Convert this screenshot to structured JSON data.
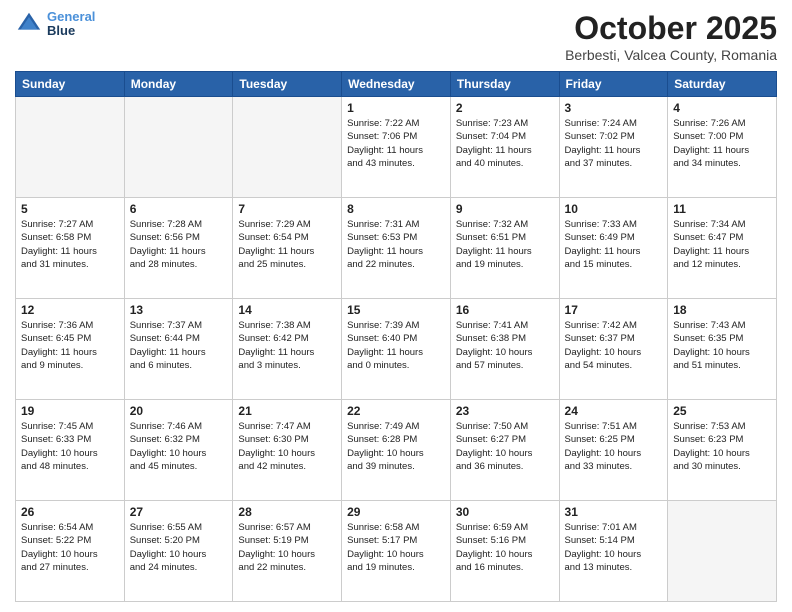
{
  "header": {
    "logo": {
      "line1": "General",
      "line2": "Blue"
    },
    "month": "October 2025",
    "location": "Berbesti, Valcea County, Romania"
  },
  "weekdays": [
    "Sunday",
    "Monday",
    "Tuesday",
    "Wednesday",
    "Thursday",
    "Friday",
    "Saturday"
  ],
  "weeks": [
    [
      {
        "day": "",
        "info": ""
      },
      {
        "day": "",
        "info": ""
      },
      {
        "day": "",
        "info": ""
      },
      {
        "day": "1",
        "info": "Sunrise: 7:22 AM\nSunset: 7:06 PM\nDaylight: 11 hours\nand 43 minutes."
      },
      {
        "day": "2",
        "info": "Sunrise: 7:23 AM\nSunset: 7:04 PM\nDaylight: 11 hours\nand 40 minutes."
      },
      {
        "day": "3",
        "info": "Sunrise: 7:24 AM\nSunset: 7:02 PM\nDaylight: 11 hours\nand 37 minutes."
      },
      {
        "day": "4",
        "info": "Sunrise: 7:26 AM\nSunset: 7:00 PM\nDaylight: 11 hours\nand 34 minutes."
      }
    ],
    [
      {
        "day": "5",
        "info": "Sunrise: 7:27 AM\nSunset: 6:58 PM\nDaylight: 11 hours\nand 31 minutes."
      },
      {
        "day": "6",
        "info": "Sunrise: 7:28 AM\nSunset: 6:56 PM\nDaylight: 11 hours\nand 28 minutes."
      },
      {
        "day": "7",
        "info": "Sunrise: 7:29 AM\nSunset: 6:54 PM\nDaylight: 11 hours\nand 25 minutes."
      },
      {
        "day": "8",
        "info": "Sunrise: 7:31 AM\nSunset: 6:53 PM\nDaylight: 11 hours\nand 22 minutes."
      },
      {
        "day": "9",
        "info": "Sunrise: 7:32 AM\nSunset: 6:51 PM\nDaylight: 11 hours\nand 19 minutes."
      },
      {
        "day": "10",
        "info": "Sunrise: 7:33 AM\nSunset: 6:49 PM\nDaylight: 11 hours\nand 15 minutes."
      },
      {
        "day": "11",
        "info": "Sunrise: 7:34 AM\nSunset: 6:47 PM\nDaylight: 11 hours\nand 12 minutes."
      }
    ],
    [
      {
        "day": "12",
        "info": "Sunrise: 7:36 AM\nSunset: 6:45 PM\nDaylight: 11 hours\nand 9 minutes."
      },
      {
        "day": "13",
        "info": "Sunrise: 7:37 AM\nSunset: 6:44 PM\nDaylight: 11 hours\nand 6 minutes."
      },
      {
        "day": "14",
        "info": "Sunrise: 7:38 AM\nSunset: 6:42 PM\nDaylight: 11 hours\nand 3 minutes."
      },
      {
        "day": "15",
        "info": "Sunrise: 7:39 AM\nSunset: 6:40 PM\nDaylight: 11 hours\nand 0 minutes."
      },
      {
        "day": "16",
        "info": "Sunrise: 7:41 AM\nSunset: 6:38 PM\nDaylight: 10 hours\nand 57 minutes."
      },
      {
        "day": "17",
        "info": "Sunrise: 7:42 AM\nSunset: 6:37 PM\nDaylight: 10 hours\nand 54 minutes."
      },
      {
        "day": "18",
        "info": "Sunrise: 7:43 AM\nSunset: 6:35 PM\nDaylight: 10 hours\nand 51 minutes."
      }
    ],
    [
      {
        "day": "19",
        "info": "Sunrise: 7:45 AM\nSunset: 6:33 PM\nDaylight: 10 hours\nand 48 minutes."
      },
      {
        "day": "20",
        "info": "Sunrise: 7:46 AM\nSunset: 6:32 PM\nDaylight: 10 hours\nand 45 minutes."
      },
      {
        "day": "21",
        "info": "Sunrise: 7:47 AM\nSunset: 6:30 PM\nDaylight: 10 hours\nand 42 minutes."
      },
      {
        "day": "22",
        "info": "Sunrise: 7:49 AM\nSunset: 6:28 PM\nDaylight: 10 hours\nand 39 minutes."
      },
      {
        "day": "23",
        "info": "Sunrise: 7:50 AM\nSunset: 6:27 PM\nDaylight: 10 hours\nand 36 minutes."
      },
      {
        "day": "24",
        "info": "Sunrise: 7:51 AM\nSunset: 6:25 PM\nDaylight: 10 hours\nand 33 minutes."
      },
      {
        "day": "25",
        "info": "Sunrise: 7:53 AM\nSunset: 6:23 PM\nDaylight: 10 hours\nand 30 minutes."
      }
    ],
    [
      {
        "day": "26",
        "info": "Sunrise: 6:54 AM\nSunset: 5:22 PM\nDaylight: 10 hours\nand 27 minutes."
      },
      {
        "day": "27",
        "info": "Sunrise: 6:55 AM\nSunset: 5:20 PM\nDaylight: 10 hours\nand 24 minutes."
      },
      {
        "day": "28",
        "info": "Sunrise: 6:57 AM\nSunset: 5:19 PM\nDaylight: 10 hours\nand 22 minutes."
      },
      {
        "day": "29",
        "info": "Sunrise: 6:58 AM\nSunset: 5:17 PM\nDaylight: 10 hours\nand 19 minutes."
      },
      {
        "day": "30",
        "info": "Sunrise: 6:59 AM\nSunset: 5:16 PM\nDaylight: 10 hours\nand 16 minutes."
      },
      {
        "day": "31",
        "info": "Sunrise: 7:01 AM\nSunset: 5:14 PM\nDaylight: 10 hours\nand 13 minutes."
      },
      {
        "day": "",
        "info": ""
      }
    ]
  ]
}
